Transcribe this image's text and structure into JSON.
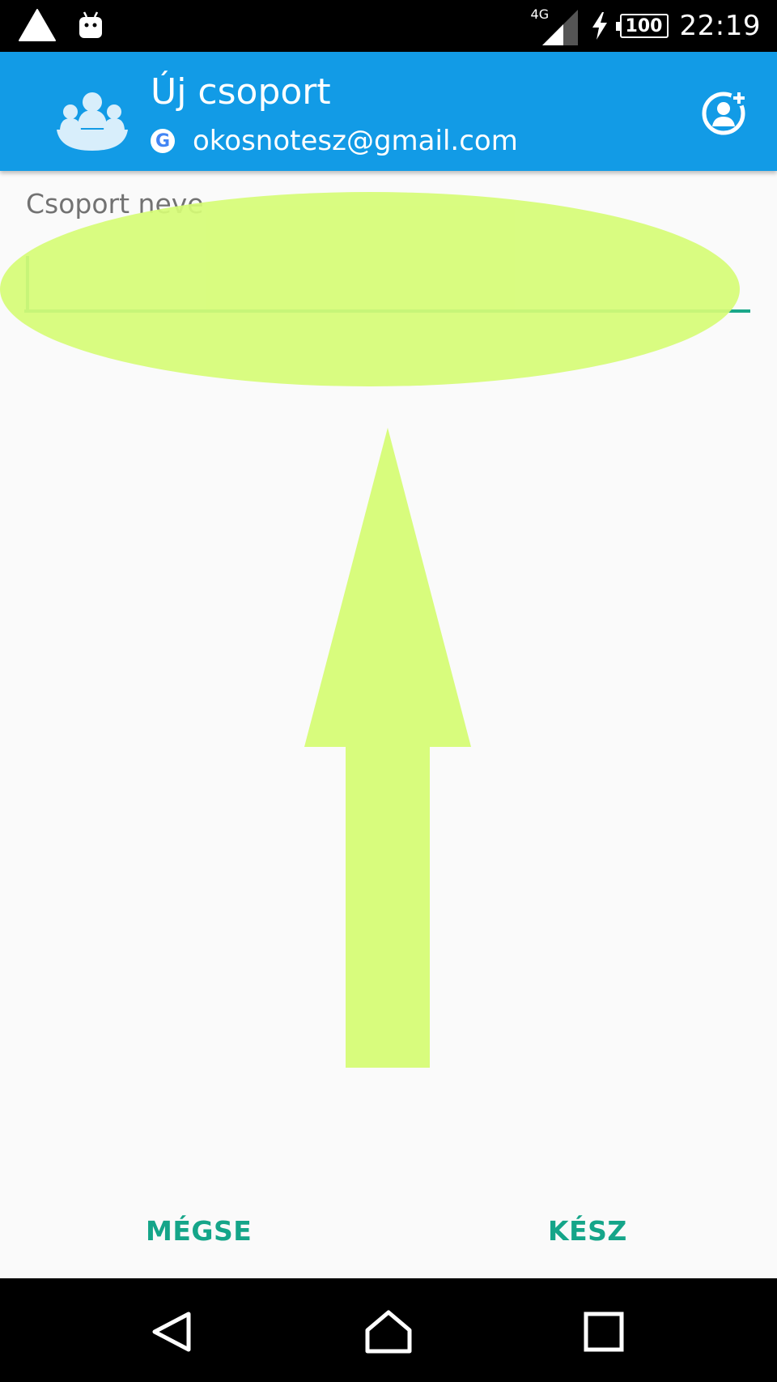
{
  "status_bar": {
    "network_type": "4G",
    "battery_level": "100",
    "time": "22:19",
    "icons": [
      "warning-triangle-icon",
      "android-icon",
      "signal-icon",
      "charging-bolt-icon",
      "battery-icon"
    ]
  },
  "app_bar": {
    "title": "Új csoport",
    "account_email": "okosnotesz@gmail.com",
    "account_icon": "google-icon",
    "group_icon": "group-icon",
    "action_icon": "add-member-icon",
    "background_color": "#129be6"
  },
  "form": {
    "name_label": "Csoport neve",
    "name_value": "",
    "underline_color": "#1aa789"
  },
  "annotations": {
    "highlight_color": "#d6fc76"
  },
  "actions": {
    "cancel_label": "MÉGSE",
    "done_label": "KÉSZ",
    "color": "#15a589"
  },
  "nav_bar": {
    "icons": [
      "back-icon",
      "home-icon",
      "recents-icon"
    ]
  }
}
